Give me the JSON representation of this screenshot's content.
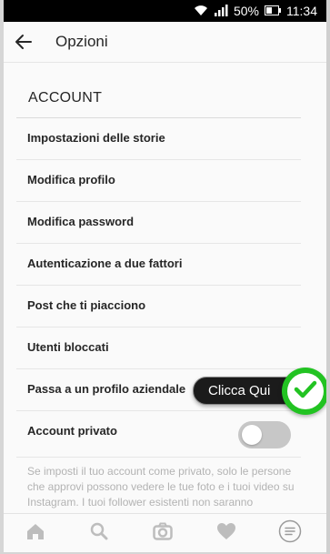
{
  "status_bar": {
    "battery": "50%",
    "time": "11:34"
  },
  "header": {
    "title": "Opzioni"
  },
  "section": {
    "title": "ACCOUNT",
    "items": [
      {
        "label": "Impostazioni delle storie"
      },
      {
        "label": "Modifica profilo"
      },
      {
        "label": "Modifica password"
      },
      {
        "label": "Autenticazione a due fattori"
      },
      {
        "label": "Post che ti piacciono"
      },
      {
        "label": "Utenti bloccati"
      },
      {
        "label": "Passa a un profilo aziendale"
      },
      {
        "label": "Account privato"
      }
    ]
  },
  "private_toggle": {
    "on": false
  },
  "info_text": "Se imposti il tuo account come privato, solo le persone che approvi possono vedere le tue foto e i tuoi video su Instagram. I tuoi follower esistenti non saranno interessati dalla modifica.",
  "annotation": {
    "tooltip": "Clicca Qui",
    "badge_color": "#22c322"
  },
  "tab_bar": {
    "tabs": [
      {
        "icon": "home-icon"
      },
      {
        "icon": "search-icon"
      },
      {
        "icon": "camera-icon"
      },
      {
        "icon": "heart-icon"
      },
      {
        "icon": "profile-menu-icon"
      }
    ]
  }
}
